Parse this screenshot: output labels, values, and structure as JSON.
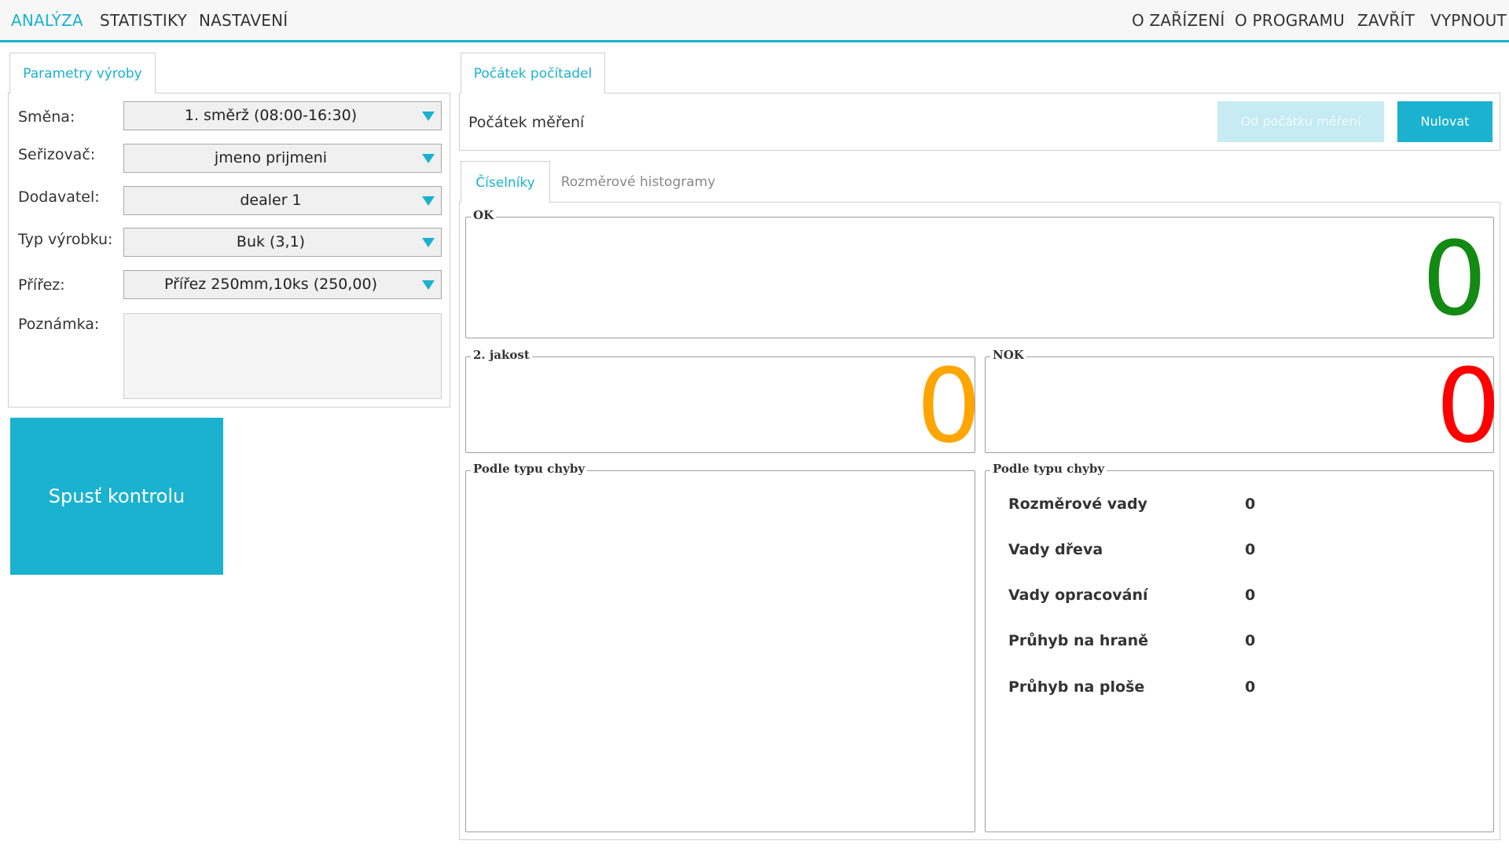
{
  "menu": {
    "left": [
      "ANALÝZA",
      "STATISTIKY",
      "NASTAVENÍ"
    ],
    "right": [
      "O ZAŘÍZENÍ",
      "O PROGRAMU",
      "ZAVŘÍT",
      "VYPNOUT"
    ],
    "active": "ANALÝZA"
  },
  "params": {
    "tab_label": "Parametry výroby",
    "shift_label": "Směna:",
    "shift_value": "1. směrž (08:00-16:30)",
    "setter_label": "Seřizovač:",
    "setter_value": "jmeno prijmeni",
    "supplier_label": "Dodavatel:",
    "supplier_value": "dealer 1",
    "product_type_label": "Typ výrobku:",
    "product_type_value": "Buk (3,1)",
    "cut_label": "Přířez:",
    "cut_value": "Přířez 250mm,10ks (250,00)",
    "note_label": "Poznámka:",
    "note_value": ""
  },
  "start_button": "Spusť kontrolu",
  "counters": {
    "tab_label": "Počátek počítadel",
    "start_label": "Počátek měření",
    "from_start_button": "Od počátku měření",
    "reset_button": "Nulovat"
  },
  "view_tabs": {
    "numbers": "Číselníky",
    "histograms": "Rozměrové histogramy"
  },
  "ok": {
    "title": "OK",
    "value": "0",
    "color": "#138a13"
  },
  "second_quality": {
    "title": "2. jakost",
    "value": "0",
    "color": "#ffa500"
  },
  "nok": {
    "title": "NOK",
    "value": "0",
    "color": "#ff0000"
  },
  "by_type_left": {
    "title": "Podle typu chyby"
  },
  "by_type_right": {
    "title": "Podle typu chyby",
    "rows": [
      {
        "label": "Rozměrové vady",
        "value": "0"
      },
      {
        "label": "Vady dřeva",
        "value": "0"
      },
      {
        "label": "Vady opracování",
        "value": "0"
      },
      {
        "label": "Průhyb na hraně",
        "value": "0"
      },
      {
        "label": "Průhyb na ploše",
        "value": "0"
      }
    ]
  },
  "colors": {
    "accent": "#1ab2cf"
  }
}
